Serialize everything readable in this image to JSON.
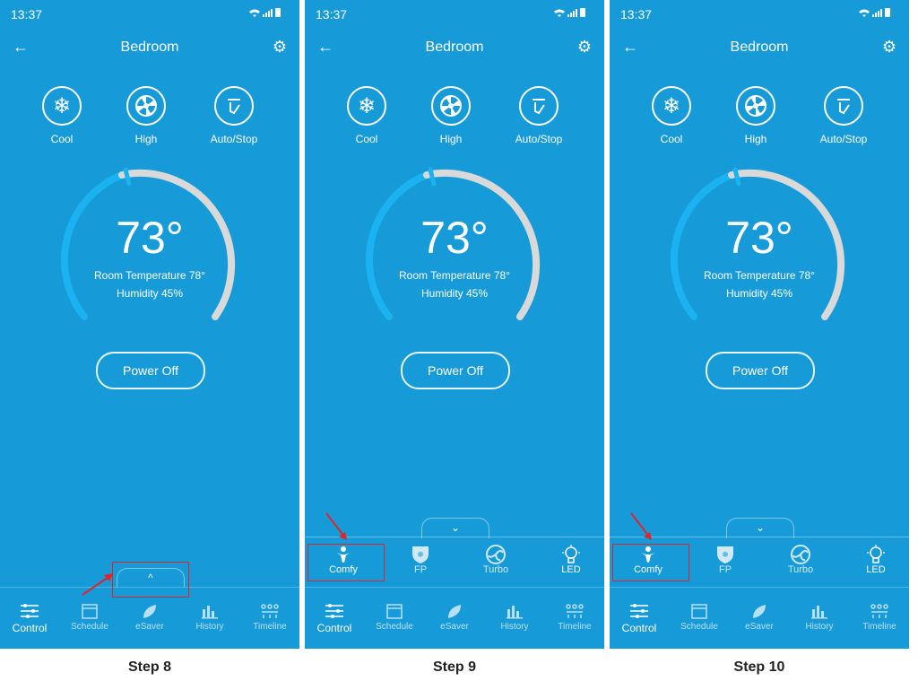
{
  "status": {
    "time": "13:37"
  },
  "header": {
    "title": "Bedroom"
  },
  "modes": [
    {
      "label": "Cool",
      "icon": "snowflake-icon"
    },
    {
      "label": "High",
      "icon": "fan-icon"
    },
    {
      "label": "Auto/Stop",
      "icon": "auto-stop-icon"
    }
  ],
  "thermostat": {
    "temp": "73°",
    "room": "Room Temperature 78°",
    "humidity": "Humidity 45%"
  },
  "power_label": "Power Off",
  "features": [
    {
      "label": "Comfy",
      "icon": "person-icon"
    },
    {
      "label": "FP",
      "icon": "fp-shield-icon"
    },
    {
      "label": "Turbo",
      "icon": "turbo-swirl-icon"
    },
    {
      "label": "LED",
      "icon": "bulb-icon"
    }
  ],
  "nav": [
    {
      "label": "Control",
      "icon": "sliders-icon"
    },
    {
      "label": "Schedule",
      "icon": "calendar-icon"
    },
    {
      "label": "eSaver",
      "icon": "leaf-icon"
    },
    {
      "label": "History",
      "icon": "bar-chart-icon"
    },
    {
      "label": "Timeline",
      "icon": "timeline-icon"
    }
  ],
  "steps": [
    "Step 8",
    "Step 9",
    "Step 10"
  ],
  "colors": {
    "panel_bg": "#169ad8",
    "arc_active": "#1ab2f0",
    "arc_inactive": "#d9d9d9",
    "annotation_red": "#e0252a"
  }
}
